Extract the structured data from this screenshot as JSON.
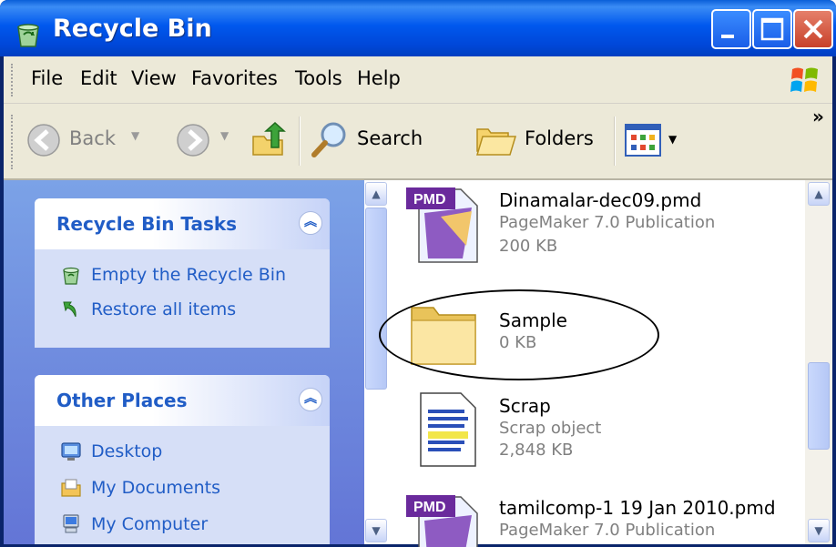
{
  "window": {
    "title": "Recycle Bin",
    "accent": "#0055e5"
  },
  "menu": {
    "items": [
      "File",
      "Edit",
      "View",
      "Favorites",
      "Tools",
      "Help"
    ]
  },
  "toolbar": {
    "back_label": "Back",
    "search_label": "Search",
    "folders_label": "Folders",
    "overflow": "»"
  },
  "tasks": {
    "title": "Recycle Bin Tasks",
    "items": [
      {
        "label": "Empty the Recycle Bin",
        "icon": "empty-bin-icon"
      },
      {
        "label": "Restore all items",
        "icon": "restore-icon"
      }
    ]
  },
  "places": {
    "title": "Other Places",
    "items": [
      {
        "label": "Desktop",
        "icon": "desktop-icon"
      },
      {
        "label": "My Documents",
        "icon": "my-documents-icon"
      },
      {
        "label": "My Computer",
        "icon": "my-computer-icon"
      }
    ]
  },
  "files": [
    {
      "name": "Dinamalar-dec09.pmd",
      "type": "PageMaker 7.0 Publication",
      "size": "200 KB",
      "badge": "PMD"
    },
    {
      "name": "Sample",
      "type": "",
      "size": "0 KB"
    },
    {
      "name": "Scrap",
      "type": "Scrap object",
      "size": "2,848 KB"
    },
    {
      "name": "tamilcomp-1 19 Jan 2010.pmd",
      "type": "PageMaker 7.0 Publication",
      "size": "",
      "badge": "PMD"
    }
  ]
}
